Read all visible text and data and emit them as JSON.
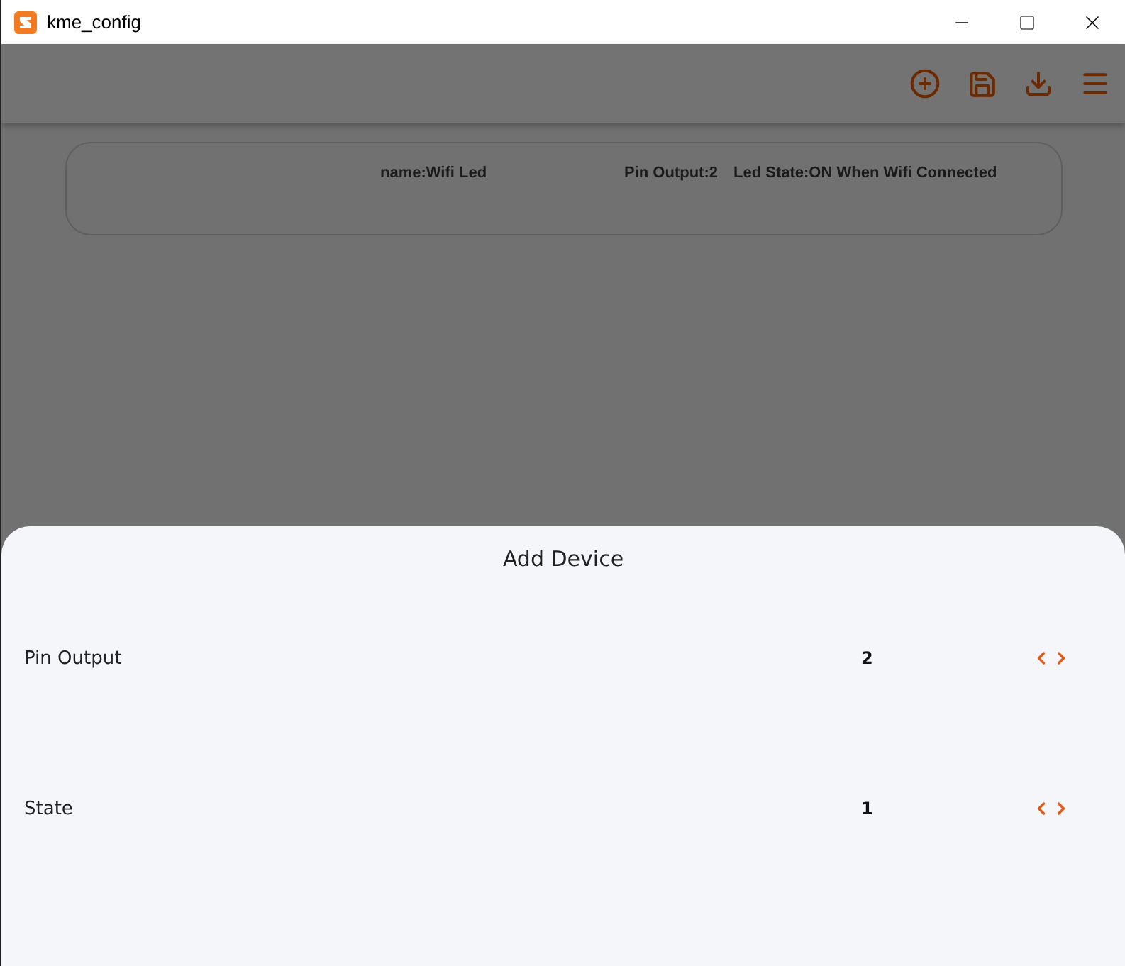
{
  "window": {
    "title": "kme_config"
  },
  "devices": [
    {
      "name": "name:Wifi Led",
      "pin": "Pin Output:2",
      "state": "Led State:ON When Wifi Connected"
    }
  ],
  "sheet": {
    "title": "Add Device",
    "fields": [
      {
        "label": "Pin Output",
        "value": "2"
      },
      {
        "label": "State",
        "value": "1"
      }
    ]
  }
}
